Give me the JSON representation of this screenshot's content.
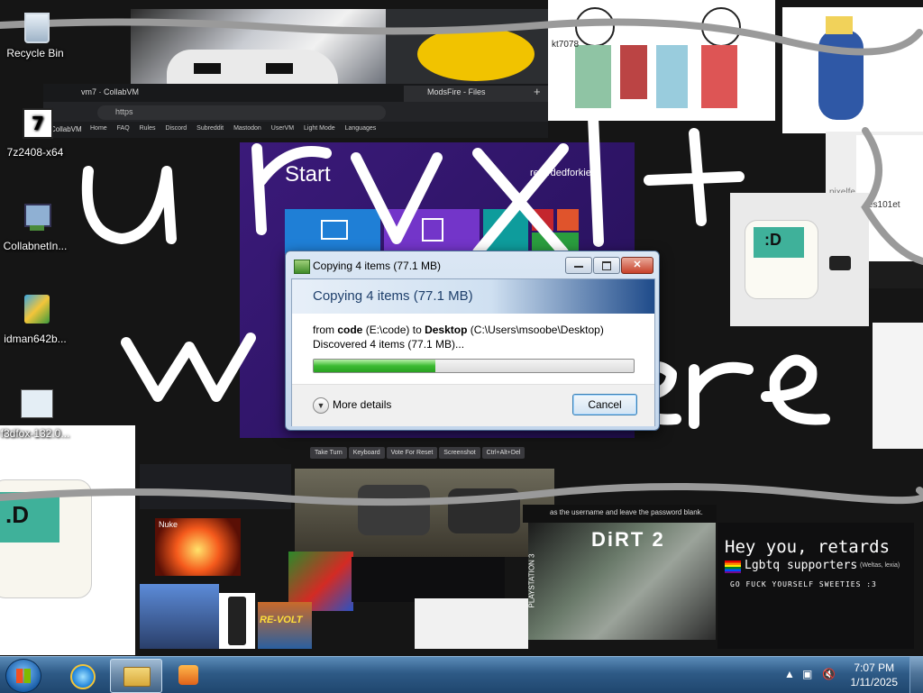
{
  "desktop_icons": [
    {
      "label": "Recycle Bin",
      "icon": "recycle-bin-icon"
    },
    {
      "label": "7z2408-x64",
      "icon": "7zip-icon"
    },
    {
      "label": "CollabnetIn...",
      "icon": "installer-icon"
    },
    {
      "label": "idman642b...",
      "icon": "setup-shield-icon"
    },
    {
      "label": "f3dfox-132.0...",
      "icon": "document-icon"
    }
  ],
  "browser": {
    "tab1": "vm7 · CollabVM",
    "tab2": "ModsFire - Files",
    "address": "https",
    "brand": "CollabVM",
    "nav": [
      "Home",
      "FAQ",
      "Rules",
      "Discord",
      "Subreddit",
      "Mastodon",
      "UserVM",
      "Light Mode",
      "Languages"
    ],
    "vm_start": "Start",
    "vm_user": "retardedforkie",
    "vm_buttons": [
      "Take Turn",
      "Keyboard",
      "Vote For Reset",
      "Screenshot",
      "Ctrl+Alt+Del"
    ]
  },
  "overlay": {
    "top_chat": "kt7078",
    "pixelfe": "pixelfe",
    "yes": "yes101et",
    "face": ":D",
    "face_small": ".D",
    "nuke": "Nuke",
    "chat_line": "as the username and leave the password blank.",
    "dirt": "DiRT 2",
    "ps3": "PLAYSTATION 3",
    "revolt": "RE-VOLT",
    "heading": "Hey you, retards",
    "sub": "Lgbtq supporters",
    "sub_note": "(Weltas, lexia)",
    "go": "GO FUCK YOURSELF SWEETIES :3",
    "handwriting": "ourvxlt weere"
  },
  "dialog": {
    "title": "Copying 4 items (77.1 MB)",
    "heading": "Copying 4 items (77.1 MB)",
    "from_label": "from",
    "source_name": "code",
    "source_path": "(E:\\code)",
    "to_label": "to",
    "dest_name": "Desktop",
    "dest_path": "(C:\\Users\\msoobe\\Desktop)",
    "status": "Discovered 4 items (77.1 MB)...",
    "progress": 0.38,
    "more_details": "More details",
    "cancel": "Cancel"
  },
  "taskbar": {
    "time": "7:07 PM",
    "date": "1/11/2025",
    "pinned": [
      "internet-explorer-icon",
      "windows-explorer-icon",
      "media-player-icon"
    ]
  },
  "colors": {
    "dialog_header_dark": "#1f4b8a",
    "progress_green": "#3cbb32",
    "vm_purple": "#3b1a7a",
    "taskbar": "#2e5a86"
  }
}
